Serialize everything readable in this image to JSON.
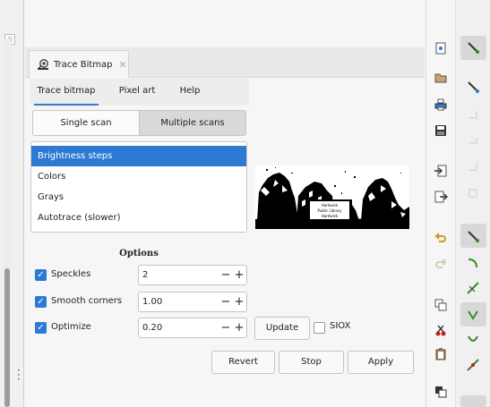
{
  "dock": {
    "tab_label": "Trace Bitmap",
    "tab_close": "✕"
  },
  "subtabs": [
    {
      "label": "Trace bitmap",
      "active": true
    },
    {
      "label": "Pixel art",
      "active": false
    },
    {
      "label": "Help",
      "active": false
    }
  ],
  "scan_mode": {
    "single_label": "Single scan",
    "multi_label": "Multiple scans",
    "selected": "Multiple scans"
  },
  "modes": [
    {
      "label": "Brightness steps",
      "selected": true
    },
    {
      "label": "Colors",
      "selected": false
    },
    {
      "label": "Grays",
      "selected": false
    },
    {
      "label": "Autotrace (slower)",
      "selected": false
    }
  ],
  "options": {
    "title": "Options",
    "speckles": {
      "label": "Speckles",
      "value": "2",
      "checked": true
    },
    "smooth_corners": {
      "label": "Smooth corners",
      "value": "1.00",
      "checked": true
    },
    "optimize": {
      "label": "Optimize",
      "value": "0.20",
      "checked": true
    }
  },
  "spin": {
    "minus": "−",
    "plus": "+"
  },
  "preview": {
    "sign_lines": [
      "Hardwick",
      "Public Library",
      "Hardwick"
    ]
  },
  "actions": {
    "update_label": "Update",
    "siox_label": "SIOX",
    "siox_checked": false,
    "revert_label": "Revert",
    "stop_label": "Stop",
    "apply_label": "Apply"
  },
  "colors": {
    "accent": "#2d7ad5",
    "connector_green": "#3a8a2a"
  }
}
